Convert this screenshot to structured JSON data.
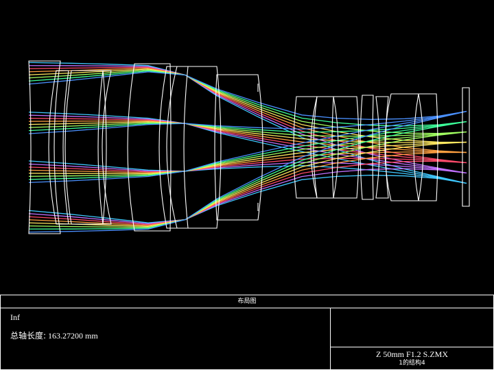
{
  "footer": {
    "title": "布局图",
    "units": "Inf",
    "axis_length_label": "总轴长度:",
    "axis_length_value": "163.27200 mm",
    "file_name": "Z 50mm F1.2 S.ZMX",
    "config": "1的结构4"
  },
  "colors": {
    "background": "#000000",
    "lens": "#ffffff",
    "rays": [
      "#3fc8ff",
      "#c070ff",
      "#ff4a6a",
      "#ffa040",
      "#ffe860",
      "#a0ff60",
      "#3cff9a",
      "#4a90ff"
    ]
  }
}
